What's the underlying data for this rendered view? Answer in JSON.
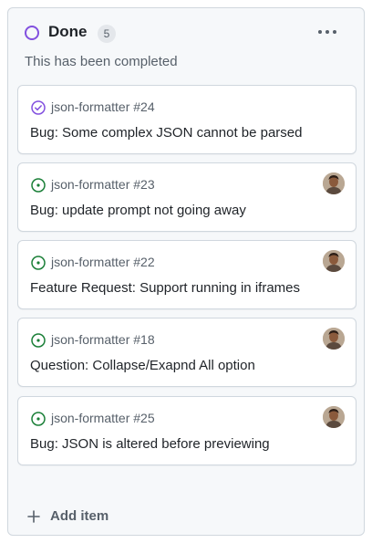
{
  "column": {
    "title": "Done",
    "count": "5",
    "description": "This has been completed",
    "status_color": "#8250df"
  },
  "cards": [
    {
      "repo_ref": "json-formatter #24",
      "title": "Bug: Some complex JSON cannot be parsed",
      "state": "completed",
      "icon": "check-circle-icon",
      "has_avatar": false
    },
    {
      "repo_ref": "json-formatter #23",
      "title": "Bug: update prompt not going away",
      "state": "open",
      "icon": "issue-opened-icon",
      "has_avatar": true
    },
    {
      "repo_ref": "json-formatter #22",
      "title": "Feature Request: Support running in iframes",
      "state": "open",
      "icon": "issue-opened-icon",
      "has_avatar": true
    },
    {
      "repo_ref": "json-formatter #18",
      "title": "Question: Collapse/Exapnd All option",
      "state": "open",
      "icon": "issue-opened-icon",
      "has_avatar": true
    },
    {
      "repo_ref": "json-formatter #25",
      "title": "Bug: JSON is altered before previewing",
      "state": "open",
      "icon": "issue-opened-icon",
      "has_avatar": true
    }
  ],
  "footer": {
    "add_item_label": "Add item",
    "icon": "plus-icon"
  },
  "colors": {
    "open_green": "#1a7f37",
    "done_purple": "#8250df"
  }
}
